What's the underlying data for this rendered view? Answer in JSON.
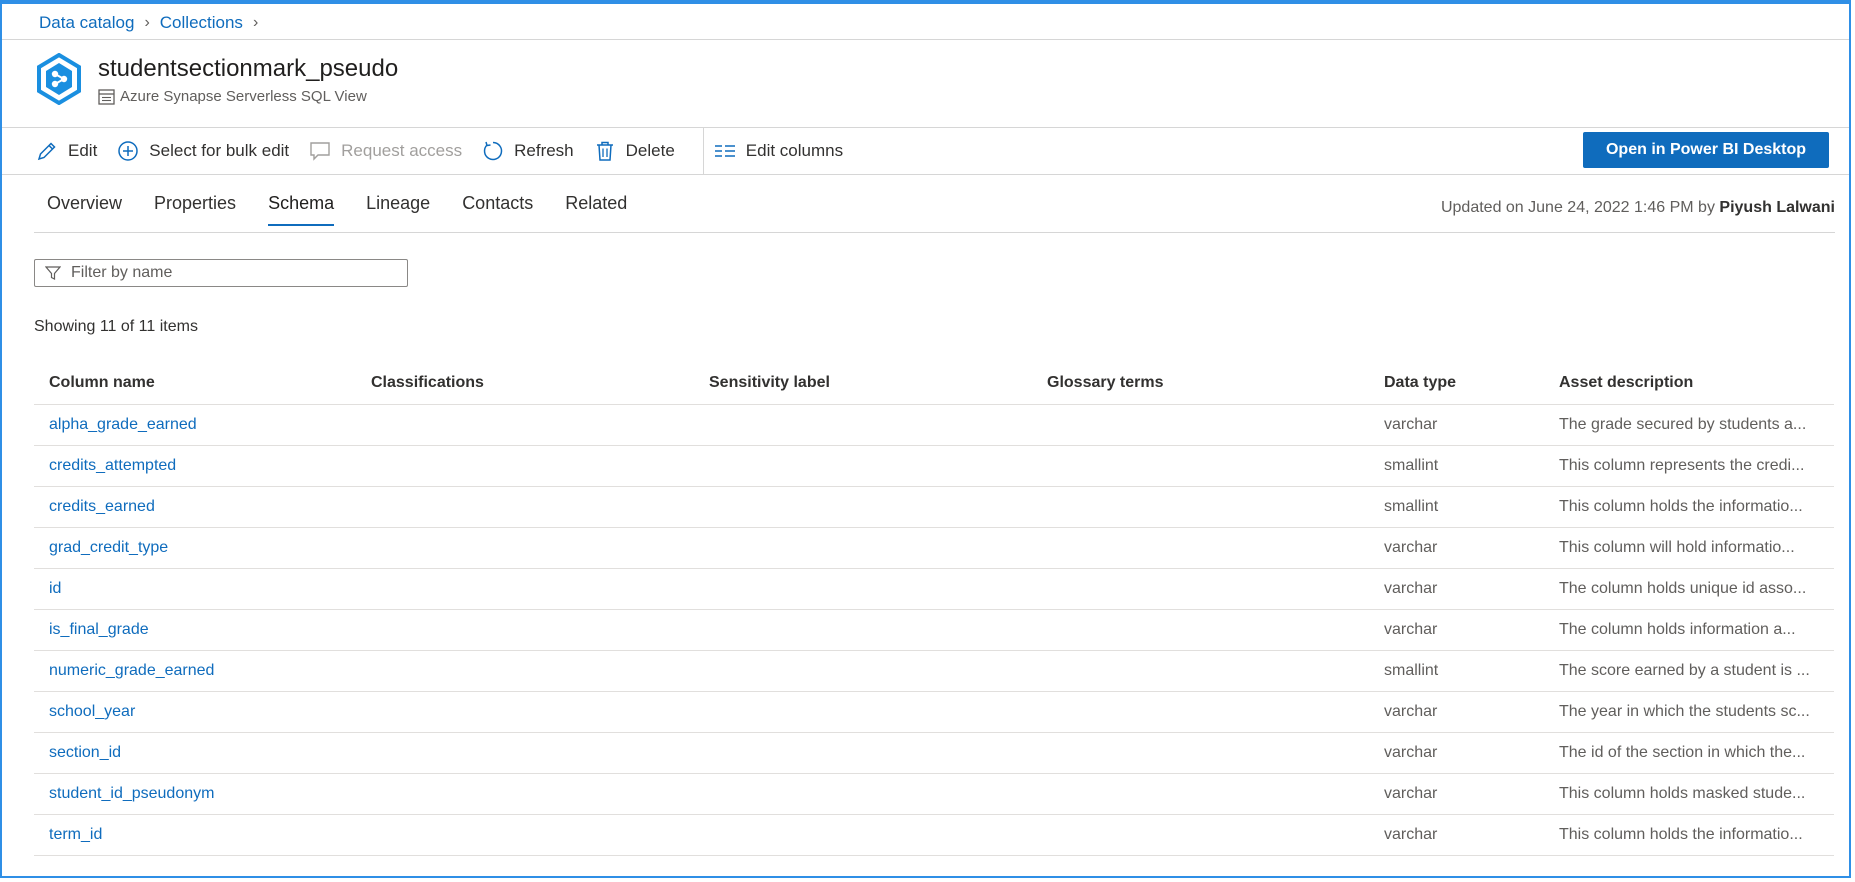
{
  "breadcrumb": [
    {
      "label": "Data catalog"
    },
    {
      "label": "Collections"
    }
  ],
  "asset": {
    "title": "studentsectionmark_pseudo",
    "type": "Azure Synapse Serverless SQL View"
  },
  "toolbar": {
    "edit": "Edit",
    "bulk_edit": "Select for bulk edit",
    "request_access": "Request access",
    "refresh": "Refresh",
    "delete": "Delete",
    "edit_columns": "Edit columns",
    "open_pbi": "Open in Power BI Desktop"
  },
  "tabs": [
    "Overview",
    "Properties",
    "Schema",
    "Lineage",
    "Contacts",
    "Related"
  ],
  "active_tab": "Schema",
  "updated": {
    "text": "Updated on June 24, 2022 1:46 PM by",
    "by": "Piyush Lalwani"
  },
  "filter": {
    "placeholder": "Filter by name"
  },
  "showing": "Showing 11 of 11 items",
  "table": {
    "headers": [
      "Column name",
      "Classifications",
      "Sensitivity label",
      "Glossary terms",
      "Data type",
      "Asset description"
    ],
    "rows": [
      {
        "name": "alpha_grade_earned",
        "type": "varchar",
        "desc": "The grade secured by students a..."
      },
      {
        "name": "credits_attempted",
        "type": "smallint",
        "desc": "This column represents the credi..."
      },
      {
        "name": "credits_earned",
        "type": "smallint",
        "desc": "This column holds the informatio..."
      },
      {
        "name": "grad_credit_type",
        "type": "varchar",
        "desc": "This column will hold informatio..."
      },
      {
        "name": "id",
        "type": "varchar",
        "desc": "The column holds unique id asso..."
      },
      {
        "name": "is_final_grade",
        "type": "varchar",
        "desc": "The column holds information a..."
      },
      {
        "name": "numeric_grade_earned",
        "type": "smallint",
        "desc": "The score earned by a student is ..."
      },
      {
        "name": "school_year",
        "type": "varchar",
        "desc": "The year in which the students sc..."
      },
      {
        "name": "section_id",
        "type": "varchar",
        "desc": "The id of the section in which the..."
      },
      {
        "name": "student_id_pseudonym",
        "type": "varchar",
        "desc": "This column holds masked stude..."
      },
      {
        "name": "term_id",
        "type": "varchar",
        "desc": "This column holds the informatio..."
      }
    ]
  },
  "colors": {
    "accent": "#0f6cbd",
    "frame": "#2f8fe6"
  }
}
